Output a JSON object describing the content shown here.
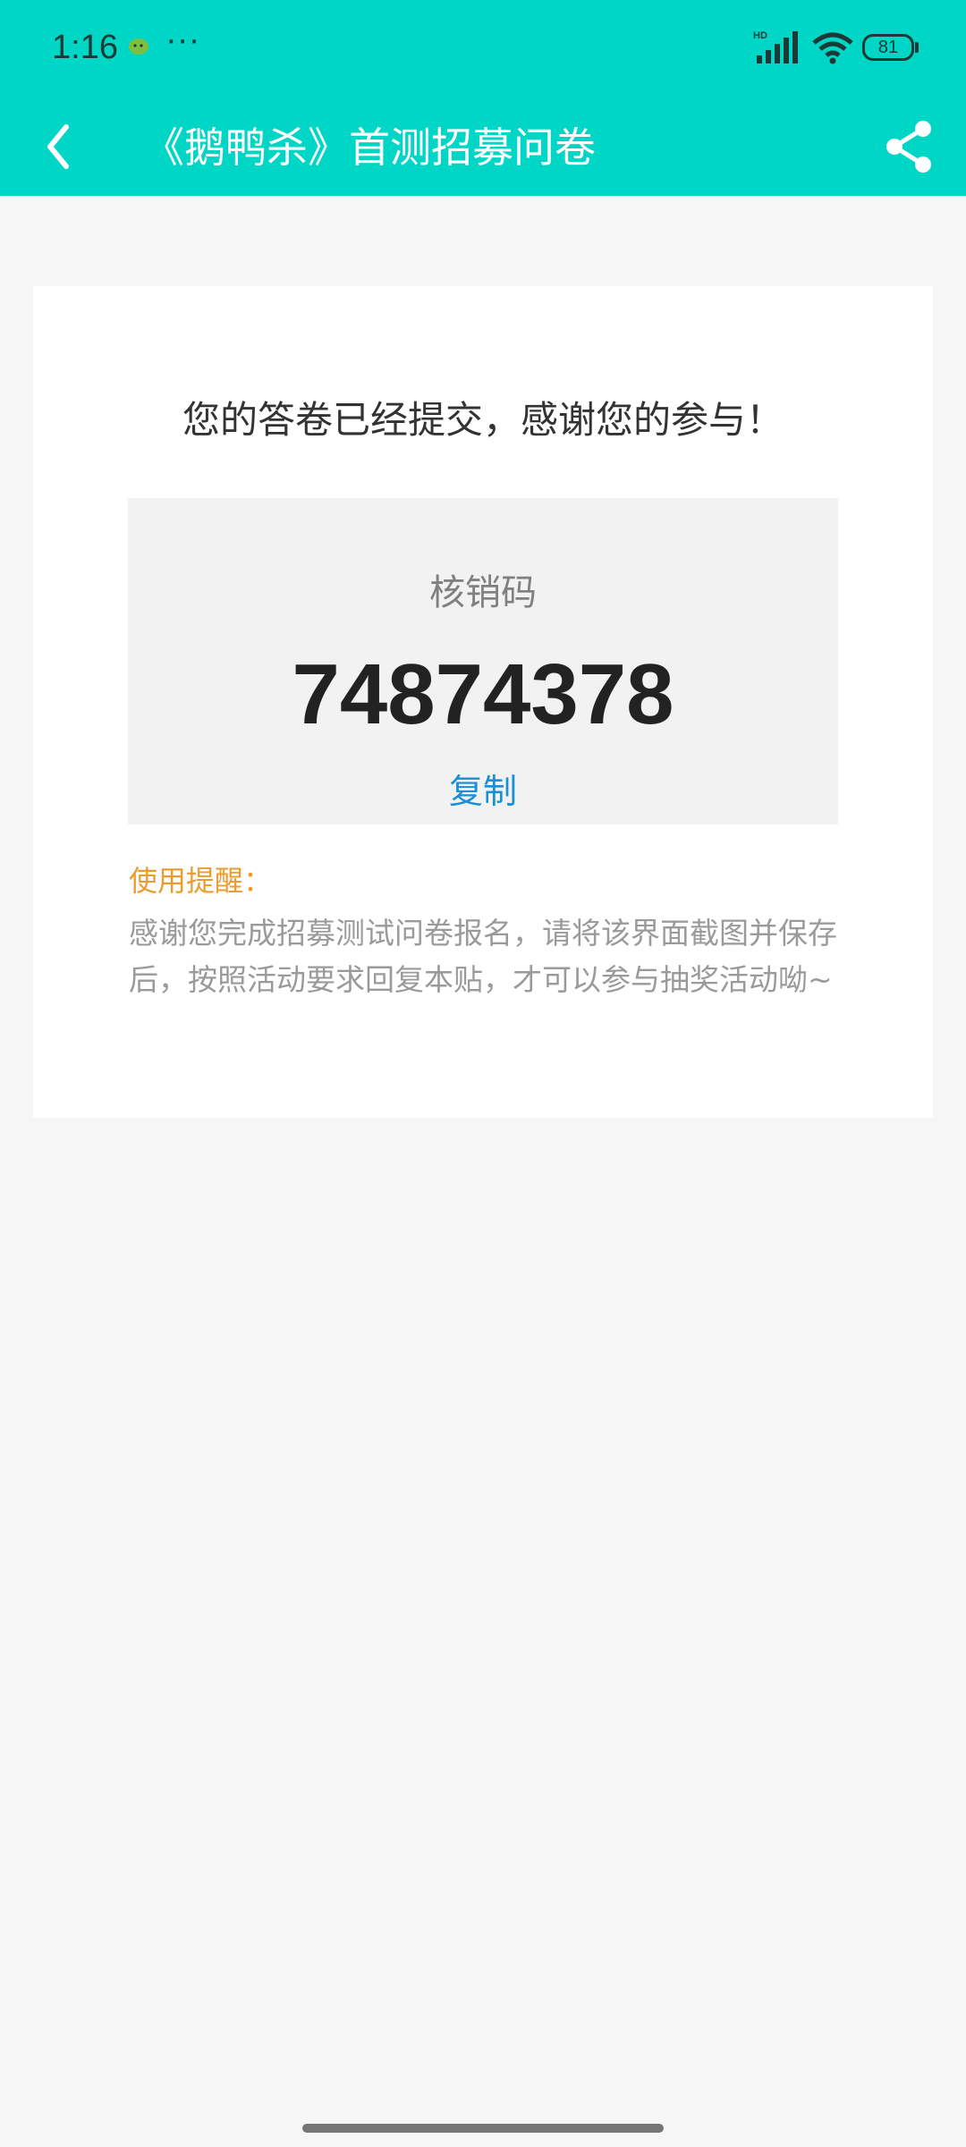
{
  "status_bar": {
    "time": "1:16",
    "more": "···",
    "battery": "81",
    "icons": [
      "wechat-icon",
      "signal-icon",
      "wifi-icon",
      "battery-icon"
    ]
  },
  "nav": {
    "title": "《鹅鸭杀》首测招募问卷",
    "back_icon": "chevron-left-icon",
    "share_icon": "share-icon"
  },
  "result": {
    "message": "您的答卷已经提交，感谢您的参与！",
    "code_label": "核销码",
    "code": "74874378",
    "copy_label": "复制",
    "tip_title": "使用提醒：",
    "tip_body": "感谢您完成招募测试问卷报名，请将该界面截图并保存后，按照活动要求回复本贴，才可以参与抽奖活动呦~"
  },
  "colors": {
    "header": "#00d6c5",
    "link": "#1a8fd6",
    "tip_title": "#eb9c2d",
    "background": "#f6f6f6"
  }
}
